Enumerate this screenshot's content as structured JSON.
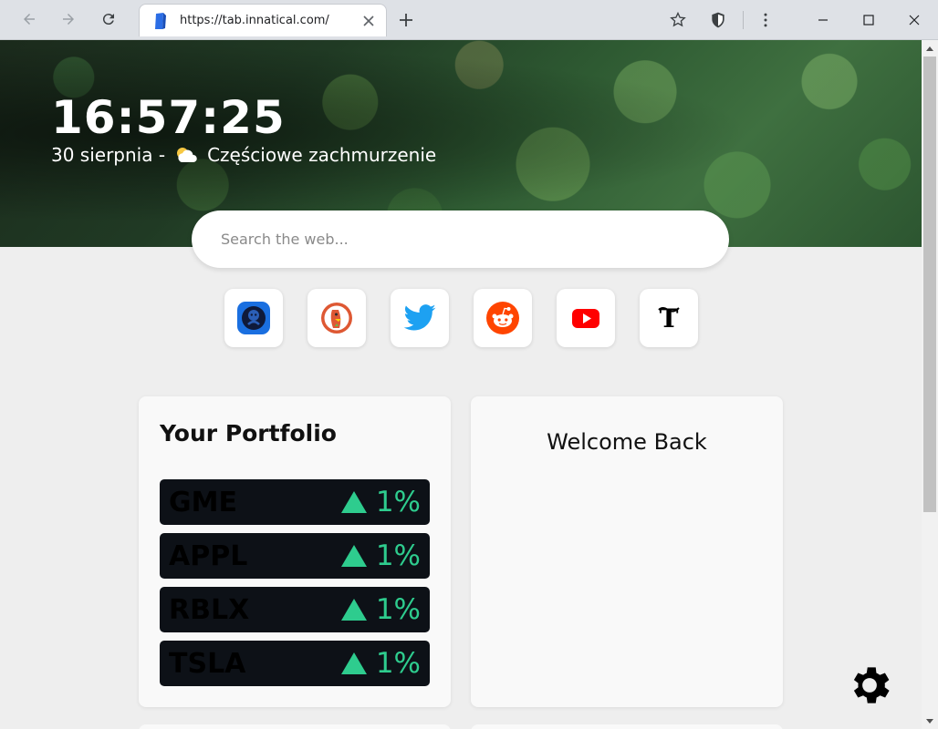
{
  "browser": {
    "tab_url": "https://tab.innatical.com/",
    "icons": {
      "back": "arrow-left-icon",
      "forward": "arrow-right-icon",
      "reload": "reload-icon",
      "new_tab": "plus-icon",
      "bookmark": "star-icon",
      "extension": "shield-icon",
      "menu": "kebab-menu-icon",
      "minimize": "minimize-icon",
      "maximize": "maximize-icon",
      "close": "close-icon"
    }
  },
  "hero": {
    "time": "16:57:25",
    "date": "30 sierpnia -",
    "weather_icon": "partly-cloudy-icon",
    "weather": "Częściowe zachmurzenie"
  },
  "search": {
    "placeholder": "Search the web..."
  },
  "shortcuts": [
    {
      "name": "github-icon",
      "color": "#1a6fe0"
    },
    {
      "name": "duckduckgo-icon",
      "color": "#de5833"
    },
    {
      "name": "twitter-icon",
      "color": "#1da1f2"
    },
    {
      "name": "reddit-icon",
      "color": "#ff4500"
    },
    {
      "name": "youtube-icon",
      "color": "#ff0000"
    },
    {
      "name": "nytimes-icon",
      "color": "#000000"
    }
  ],
  "portfolio": {
    "title": "Your Portfolio",
    "stocks": [
      {
        "ticker": "GME",
        "change": "1%"
      },
      {
        "ticker": "APPL",
        "change": "1%"
      },
      {
        "ticker": "RBLX",
        "change": "1%"
      },
      {
        "ticker": "TSLA",
        "change": "1%"
      }
    ]
  },
  "welcome": {
    "text": "Welcome Back"
  },
  "settings": {
    "icon": "gear-icon"
  },
  "colors": {
    "positive": "#2ecc8e",
    "stock_row_bg": "#0d1117",
    "page_bg": "#eeeeee"
  }
}
